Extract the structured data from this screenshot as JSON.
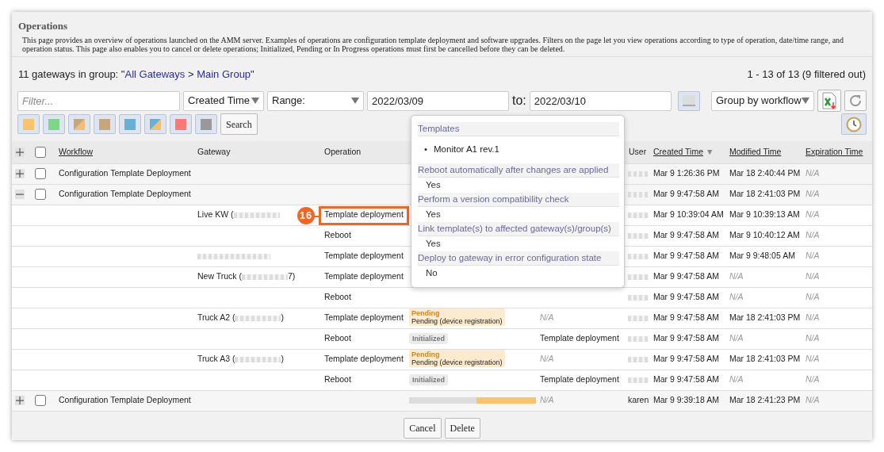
{
  "page": {
    "title": "Operations",
    "description": "This page provides an overview of operations launched on the AMM server. Examples of operations are configuration template deployment and software upgrades. Filters on the page let you view operations according to type of operation, date/time range, and operation status. This page also enables you to cancel or delete operations; Initialized, Pending or In Progress operations must first be cancelled before they can be deleted."
  },
  "group_line": {
    "prefix": "11 gateways in group: \"",
    "links": [
      "All Gateways",
      "Main Group"
    ],
    "separator": " > ",
    "suffix": "\""
  },
  "pagination": "1 - 13 of 13 (9 filtered out)",
  "toolbar": {
    "filter": {
      "placeholder": "Filter..."
    },
    "time_field": "Created Time",
    "range": "Range:",
    "from": "2022/03/09",
    "to_label": "to:",
    "to": "2022/03/10",
    "group_by": "Group by workflow",
    "search": "Search"
  },
  "status_filters": [
    {
      "color": "#fcc46a"
    },
    {
      "color": "#7ed68a"
    },
    {
      "kind": "split",
      "color": "#c8a57c"
    },
    {
      "color": "#c8a57c"
    },
    {
      "color": "#6ab0d4"
    },
    {
      "kind": "split",
      "color": "#6ab0d4"
    },
    {
      "color": "#ff7777"
    },
    {
      "color": "#999999"
    }
  ],
  "table": {
    "select_all_checked": false,
    "columns": [
      {
        "label": "Workflow",
        "link": true
      },
      {
        "label": "Gateway",
        "link": false
      },
      {
        "label": "Operation",
        "link": false
      },
      {
        "label": "User",
        "link": false
      },
      {
        "label": "Created Time",
        "link": true,
        "sort_indicator": "▼"
      },
      {
        "label": "Modified Time",
        "link": true
      },
      {
        "label": "Expiration Time",
        "link": true
      }
    ],
    "rows": [
      {
        "kind": "group",
        "expanded": false,
        "checked": false,
        "workflow": "Configuration Template Deployment",
        "user": {
          "redacted": true
        },
        "created": "Mar 9 1:26:36 PM",
        "modified": "Mar 18 2:40:44 PM",
        "expiration": "N/A"
      },
      {
        "kind": "group",
        "expanded": true,
        "checked": false,
        "workflow": "Configuration Template Deployment",
        "user": {
          "redacted": true
        },
        "created": "Mar 9 9:47:58 AM",
        "modified": "Mar 18 2:41:03 PM",
        "expiration": "N/A"
      },
      {
        "kind": "child",
        "gateway": {
          "prefix": "Live KW (",
          "redacted": true
        },
        "operation": "Template deployment",
        "highlighted": true,
        "user": {
          "redacted": true
        },
        "created": "Mar 9 10:39:04 AM",
        "modified": "Mar 9 10:39:13 AM",
        "expiration": "N/A"
      },
      {
        "kind": "child",
        "operation": "Reboot",
        "user": {
          "redacted": true
        },
        "created": "Mar 9 9:47:58 AM",
        "modified": "Mar 9 10:40:12 AM",
        "expiration": "N/A"
      },
      {
        "kind": "child",
        "gateway": {
          "redacted": true
        },
        "operation": "Template deployment",
        "user": {
          "redacted": true
        },
        "created": "Mar 9 9:47:58 AM",
        "modified": "Mar 9 9:48:05 AM",
        "expiration": "N/A"
      },
      {
        "kind": "child",
        "gateway": {
          "prefix": "New Truck (",
          "redacted": true,
          "suffix": "7)"
        },
        "operation": "Template deployment",
        "user": {
          "redacted": true
        },
        "created": "Mar 9 9:47:58 AM",
        "modified": "N/A",
        "expiration": "N/A"
      },
      {
        "kind": "child",
        "operation": "Reboot",
        "user": {
          "redacted": true
        },
        "created": "Mar 9 9:47:58 AM",
        "modified": "N/A",
        "expiration": "N/A"
      },
      {
        "kind": "child",
        "gateway": {
          "prefix": "Truck A2 (",
          "redacted": true,
          "suffix": ")"
        },
        "operation": "Template deployment",
        "status": {
          "kind": "pending",
          "label": "Pending",
          "detail": "Pending (device registration)"
        },
        "depends": "N/A",
        "user": {
          "redacted": true
        },
        "created": "Mar 9 9:47:58 AM",
        "modified": "Mar 18 2:41:03 PM",
        "expiration": "N/A"
      },
      {
        "kind": "child",
        "operation": "Reboot",
        "status": {
          "kind": "initialized",
          "label": "Initialized"
        },
        "depends": "Template deployment",
        "user": {
          "redacted": true
        },
        "created": "Mar 9 9:47:58 AM",
        "modified": "N/A",
        "expiration": "N/A"
      },
      {
        "kind": "child",
        "gateway": {
          "prefix": "Truck A3 (",
          "redacted": true,
          "suffix": ")"
        },
        "operation": "Template deployment",
        "status": {
          "kind": "pending",
          "label": "Pending",
          "detail": "Pending (device registration)"
        },
        "depends": "N/A",
        "user": {
          "redacted": true
        },
        "created": "Mar 9 9:47:58 AM",
        "modified": "Mar 18 2:41:03 PM",
        "expiration": "N/A"
      },
      {
        "kind": "child",
        "operation": "Reboot",
        "status": {
          "kind": "initialized",
          "label": "Initialized"
        },
        "depends": "Template deployment",
        "user": {
          "redacted": true
        },
        "created": "Mar 9 9:47:58 AM",
        "modified": "N/A",
        "expiration": "N/A"
      },
      {
        "kind": "group",
        "expanded": false,
        "checked": false,
        "workflow": "Configuration Template Deployment",
        "status": {
          "kind": "progress",
          "level": 0.47
        },
        "depends": "N/A",
        "user": {
          "name": "karen"
        },
        "created": "Mar 9 9:39:18 AM",
        "modified": "Mar 18 2:41:23 PM",
        "expiration": "N/A"
      }
    ]
  },
  "annotation": {
    "number": "16"
  },
  "popover": {
    "templates_title": "Templates",
    "bullet": "•",
    "templates": [
      "Monitor A1 rev.1"
    ],
    "options": [
      {
        "label": "Reboot automatically after changes are applied",
        "value": "Yes"
      },
      {
        "label": "Perform a version compatibility check",
        "value": "Yes"
      },
      {
        "label": "Link template(s) to affected gateway(s)/group(s)",
        "value": "Yes"
      },
      {
        "label": "Deploy to gateway in error configuration state",
        "value": "No"
      }
    ]
  },
  "buttons": [
    "Cancel",
    "Delete"
  ]
}
